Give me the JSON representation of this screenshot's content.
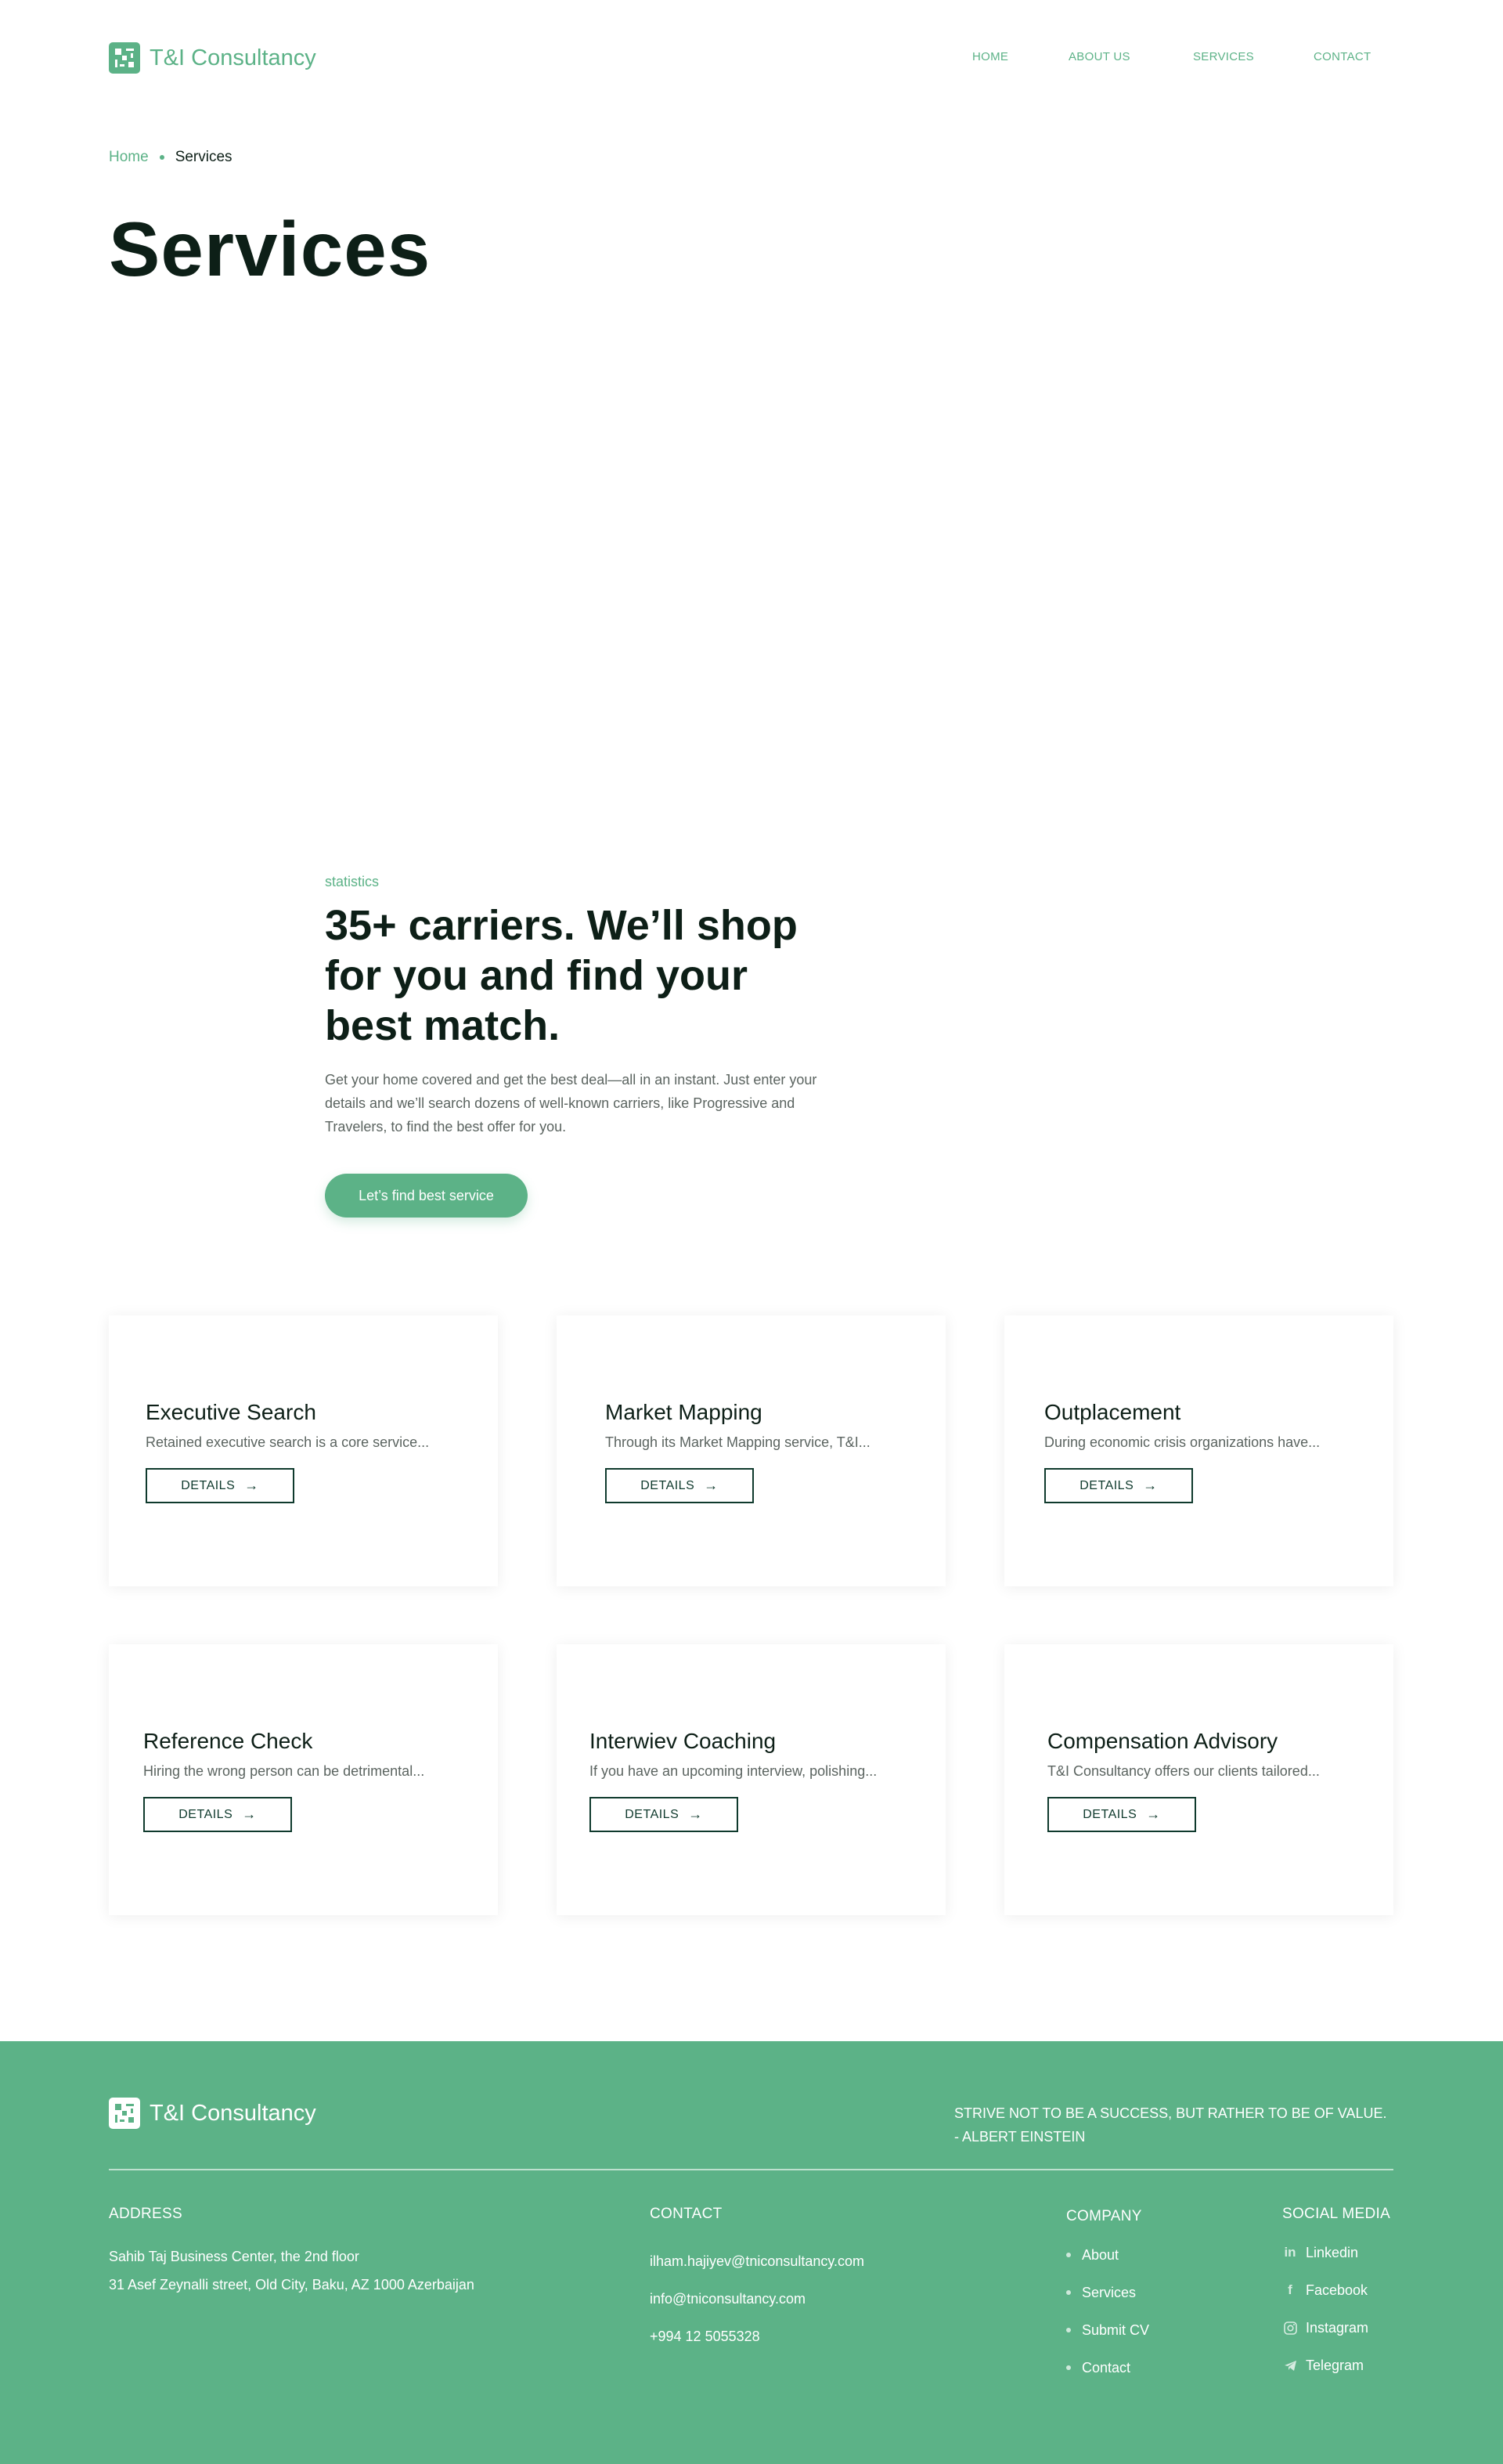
{
  "brand": {
    "name": "T&I Consultancy"
  },
  "nav": [
    "HOME",
    "ABOUT US",
    "SERVICES",
    "CONTACT"
  ],
  "breadcrumb": {
    "home": "Home",
    "current": "Services"
  },
  "page_title": "Services",
  "stats": {
    "label": "statistics",
    "heading": "35+ carriers. We’ll shop for you and find your best match.",
    "text": "Get your home covered and get the best deal—all in an instant. Just enter your details and we’ll search dozens of well-known carriers, like Progressive and Travelers, to find the best offer for you.",
    "cta": "Let’s find best service"
  },
  "services": [
    {
      "title": "Executive Search",
      "desc": "Retained executive search is a core service...",
      "button": "DETAILS"
    },
    {
      "title": "Market Mapping",
      "desc": "Through its Market Mapping service, T&I...",
      "button": "DETAILS"
    },
    {
      "title": "Outplacement",
      "desc": "During economic crisis organizations have...",
      "button": "DETAILS"
    },
    {
      "title": "Reference Check",
      "desc": "Hiring the wrong person can be detrimental...",
      "button": "DETAILS"
    },
    {
      "title": "Interwiev Coaching",
      "desc": "If you have an upcoming interview, polishing...",
      "button": "DETAILS"
    },
    {
      "title": "Compensation Advisory",
      "desc": "T&I Consultancy offers our clients tailored...",
      "button": "DETAILS"
    }
  ],
  "footer": {
    "brand": "T&I Consultancy",
    "quote_line1": "STRIVE NOT TO BE A SUCCESS, BUT RATHER TO BE OF VALUE.",
    "quote_line2": "- ALBERT EINSTEIN",
    "address_heading": "ADDRESS",
    "address_line1": "Sahib Taj Business Center, the 2nd floor",
    "address_line2": "31 Asef Zeynalli street, Old City, Baku, AZ 1000 Azerbaijan",
    "contact_heading": "CONTACT",
    "contacts": [
      "ilham.hajiyev@tniconsultancy.com",
      "info@tniconsultancy.com",
      "+994 12 5055328"
    ],
    "company_heading": "COMPANY",
    "company_links": [
      "About",
      "Services",
      "Submit CV",
      "Contact"
    ],
    "social_heading": "SOCIAL MEDIA",
    "social": [
      {
        "label": "Linkedin",
        "icon": "linkedin-icon"
      },
      {
        "label": "Facebook",
        "icon": "facebook-icon"
      },
      {
        "label": "Instagram",
        "icon": "instagram-icon"
      },
      {
        "label": "Telegram",
        "icon": "telegram-icon"
      }
    ]
  }
}
